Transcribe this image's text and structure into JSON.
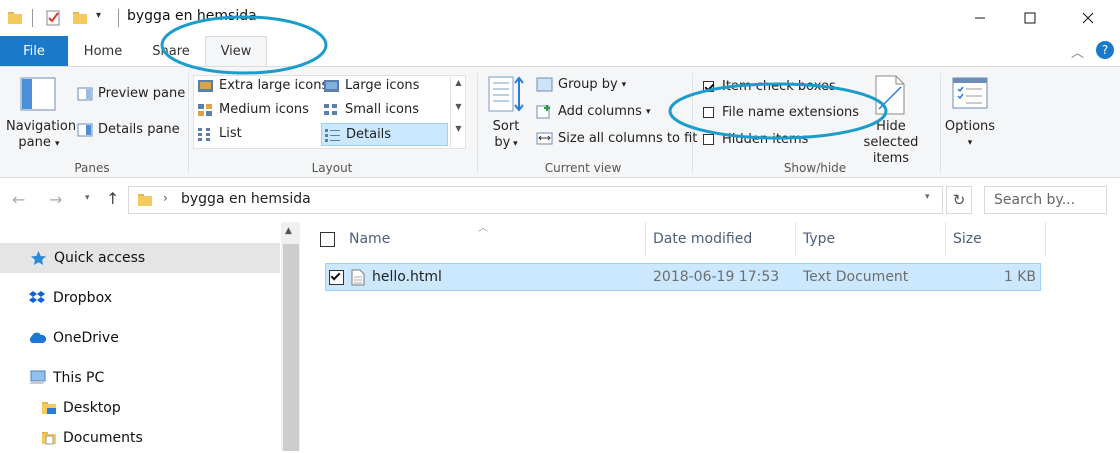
{
  "window": {
    "title": "bygga en hemsida"
  },
  "tabs": {
    "file": "File",
    "home": "Home",
    "share": "Share",
    "view": "View"
  },
  "panes": {
    "navigation_line1": "Navigation",
    "navigation_line2": "pane",
    "preview": "Preview pane",
    "details": "Details pane",
    "label": "Panes"
  },
  "layout": {
    "label": "Layout",
    "items": [
      "Extra large icons",
      "Large icons",
      "Medium icons",
      "Small icons",
      "List",
      "Details"
    ],
    "selected": "Details"
  },
  "current_view": {
    "label": "Current view",
    "sort_line1": "Sort",
    "sort_line2": "by",
    "group_by": "Group by",
    "add_columns": "Add columns",
    "size_all": "Size all columns to fit"
  },
  "show_hide": {
    "label": "Show/hide",
    "item_check_boxes": "Item check boxes",
    "item_check_boxes_checked": true,
    "file_name_extensions": "File name extensions",
    "file_name_extensions_checked": false,
    "hidden_items": "Hidden items",
    "hidden_items_checked": false,
    "hide_selected_line1": "Hide selected",
    "hide_selected_line2": "items"
  },
  "options": {
    "label": "Options"
  },
  "address": {
    "path": "bygga en hemsida",
    "search_placeholder": "Search by..."
  },
  "nav": [
    {
      "label": "Quick access",
      "icon": "star-icon",
      "selected": true
    },
    {
      "label": "Dropbox",
      "icon": "dropbox-icon"
    },
    {
      "label": "OneDrive",
      "icon": "cloud-icon"
    },
    {
      "label": "This PC",
      "icon": "computer-icon"
    },
    {
      "label": "Desktop",
      "icon": "folder-icon"
    },
    {
      "label": "Documents",
      "icon": "documents-icon"
    }
  ],
  "columns": {
    "name": "Name",
    "date": "Date modified",
    "type": "Type",
    "size": "Size"
  },
  "files": [
    {
      "name": "hello.html",
      "date": "2018-06-19 17:53",
      "type": "Text Document",
      "size": "1 KB",
      "checked": true
    }
  ],
  "colors": {
    "accent": "#1979ca",
    "annotation": "#1a9ccc",
    "selection": "#cce8ff"
  }
}
